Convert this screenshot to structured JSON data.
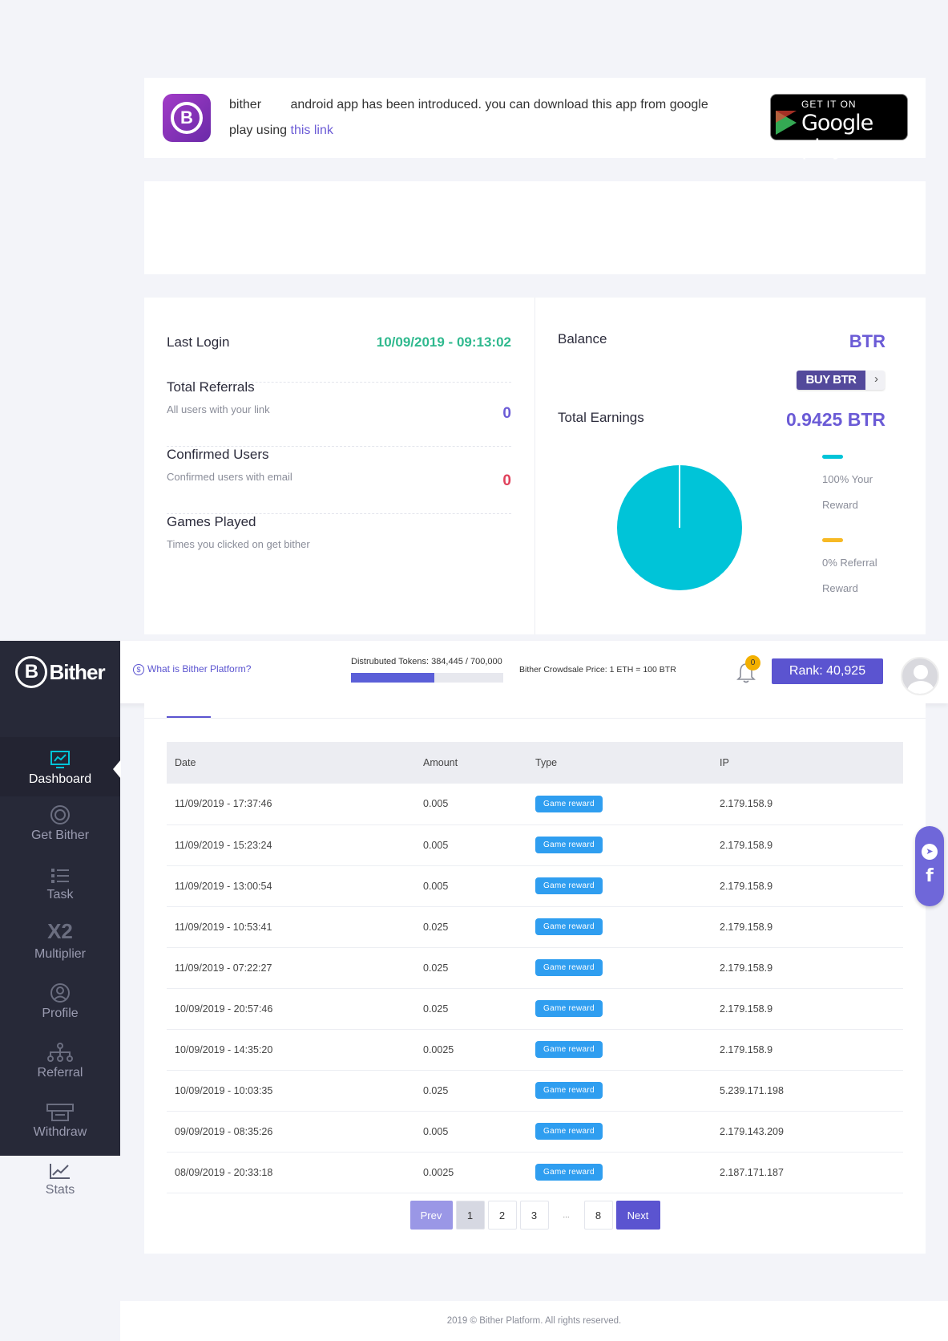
{
  "announcement": {
    "app_name": "bither",
    "message": "android app has been introduced. you can download this app from google play using",
    "link_text": "this link",
    "store_small": "GET IT ON",
    "store_big": "Google play"
  },
  "stats": {
    "last_login_label": "Last Login",
    "last_login_value": "10/09/2019 - 09:13:02",
    "total_referrals_label": "Total Referrals",
    "total_referrals_sub": "All users with your link",
    "total_referrals_value": "0",
    "confirmed_users_label": "Confirmed Users",
    "confirmed_users_sub": "Confirmed users with email",
    "confirmed_users_value": "0",
    "games_played_label": "Games Played",
    "games_played_sub": "Times you clicked on get bither",
    "games_played_value": ""
  },
  "balance": {
    "label": "Balance",
    "value": "BTR",
    "buy_label": "BUY BTR",
    "earnings_label": "Total Earnings",
    "earnings_value": "0.9425 BTR"
  },
  "chart_data": {
    "type": "pie",
    "slices": [
      {
        "label": "100% Your Reward",
        "value": 100,
        "color": "#00c4d8"
      },
      {
        "label": "0% Referral Reward",
        "value": 0,
        "color": "#f7b924"
      }
    ]
  },
  "header": {
    "brand": "Bither",
    "brand_mark": "B",
    "what_link": "What is Bither Platform?",
    "tokens_label": "Distrubuted Tokens: 384,445 / 700,000",
    "tokens_progress": 0.549,
    "price_label": "Bither Crowdsale Price: 1 ETH = 100 BTR",
    "notification_count": "0",
    "rank_label": "Rank: 40,925"
  },
  "sidebar": {
    "items": [
      {
        "label": "Dashboard"
      },
      {
        "label": "Get Bither"
      },
      {
        "label": "Task"
      },
      {
        "label": "Multiplier",
        "icon_text": "X2"
      },
      {
        "label": "Profile"
      },
      {
        "label": "Referral"
      },
      {
        "label": "Withdraw"
      },
      {
        "label": "Stats"
      }
    ]
  },
  "table": {
    "columns": [
      "Date",
      "Amount",
      "Type",
      "IP"
    ],
    "rows": [
      [
        "11/09/2019 - 17:37:46",
        "0.005",
        "Game reward",
        "2.179.158.9"
      ],
      [
        "11/09/2019 - 15:23:24",
        "0.005",
        "Game reward",
        "2.179.158.9"
      ],
      [
        "11/09/2019 - 13:00:54",
        "0.005",
        "Game reward",
        "2.179.158.9"
      ],
      [
        "11/09/2019 - 10:53:41",
        "0.025",
        "Game reward",
        "2.179.158.9"
      ],
      [
        "11/09/2019 - 07:22:27",
        "0.025",
        "Game reward",
        "2.179.158.9"
      ],
      [
        "10/09/2019 - 20:57:46",
        "0.025",
        "Game reward",
        "2.179.158.9"
      ],
      [
        "10/09/2019 - 14:35:20",
        "0.0025",
        "Game reward",
        "2.179.158.9"
      ],
      [
        "10/09/2019 - 10:03:35",
        "0.025",
        "Game reward",
        "5.239.171.198"
      ],
      [
        "09/09/2019 - 08:35:26",
        "0.005",
        "Game reward",
        "2.179.143.209"
      ],
      [
        "08/09/2019 - 20:33:18",
        "0.0025",
        "Game reward",
        "2.187.171.187"
      ]
    ]
  },
  "pagination": {
    "prev": "Prev",
    "pages": [
      "1",
      "2",
      "3",
      "...",
      "8"
    ],
    "current": "1",
    "next": "Next"
  },
  "social": {
    "facebook_glyph": "f"
  },
  "footer": {
    "text": "2019 © Bither Platform. All rights reserved."
  },
  "colors": {
    "accent": "#5b54d0",
    "sidebar": "#272938",
    "cyan": "#00c4d8",
    "yellow": "#f7b924",
    "green": "#2fb98e",
    "red": "#e0415b"
  }
}
